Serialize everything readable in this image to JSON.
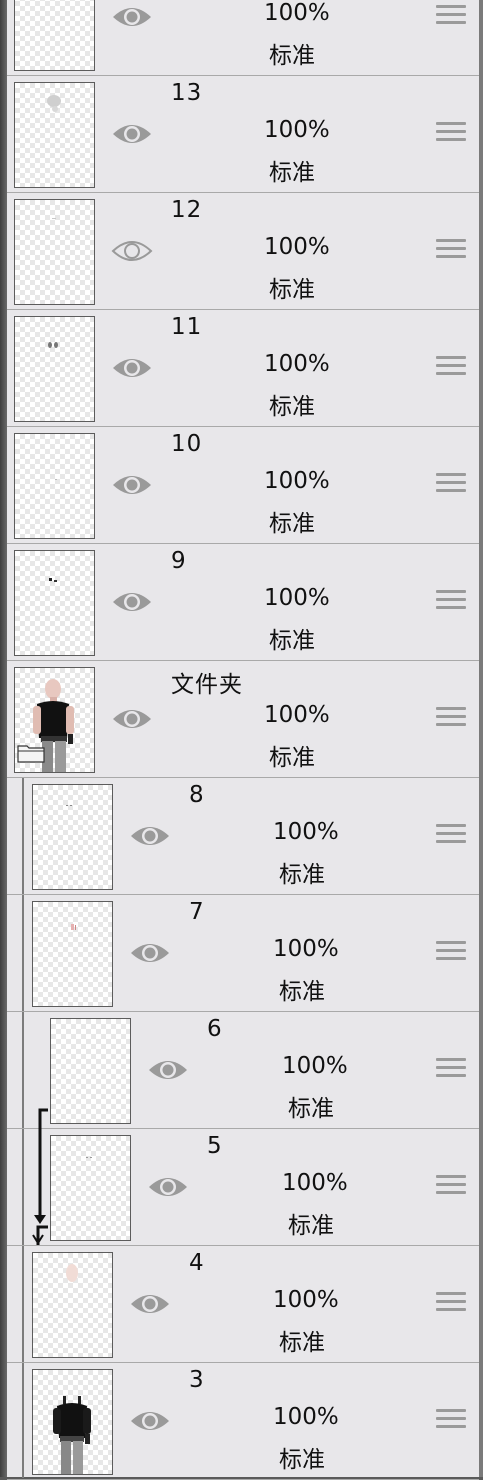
{
  "layers": [
    {
      "name": "",
      "opacity": "100%",
      "mode": "标准",
      "visible": true
    },
    {
      "name": "13",
      "opacity": "100%",
      "mode": "标准",
      "visible": true
    },
    {
      "name": "12",
      "opacity": "100%",
      "mode": "标准",
      "visible": false
    },
    {
      "name": "11",
      "opacity": "100%",
      "mode": "标准",
      "visible": true
    },
    {
      "name": "10",
      "opacity": "100%",
      "mode": "标准",
      "visible": true
    },
    {
      "name": "9",
      "opacity": "100%",
      "mode": "标准",
      "visible": true
    },
    {
      "name": "文件夹",
      "opacity": "100%",
      "mode": "标准",
      "visible": true,
      "is_folder": true
    },
    {
      "name": "8",
      "opacity": "100%",
      "mode": "标准",
      "visible": true
    },
    {
      "name": "7",
      "opacity": "100%",
      "mode": "标准",
      "visible": true
    },
    {
      "name": "6",
      "opacity": "100%",
      "mode": "标准",
      "visible": true,
      "clipped": true
    },
    {
      "name": "5",
      "opacity": "100%",
      "mode": "标准",
      "visible": true,
      "clipped": true
    },
    {
      "name": "4",
      "opacity": "100%",
      "mode": "标准",
      "visible": true
    },
    {
      "name": "3",
      "opacity": "100%",
      "mode": "标准",
      "visible": true
    }
  ],
  "icons": {
    "visibility": "eye-icon",
    "reorder": "drag-handle-icon",
    "folder": "folder-icon",
    "clipping": "clipping-arrow-icon"
  },
  "colors": {
    "panel_bg": "#e8e7ea",
    "eye": "#9a9a9a",
    "separator": "#a9a9a9"
  }
}
